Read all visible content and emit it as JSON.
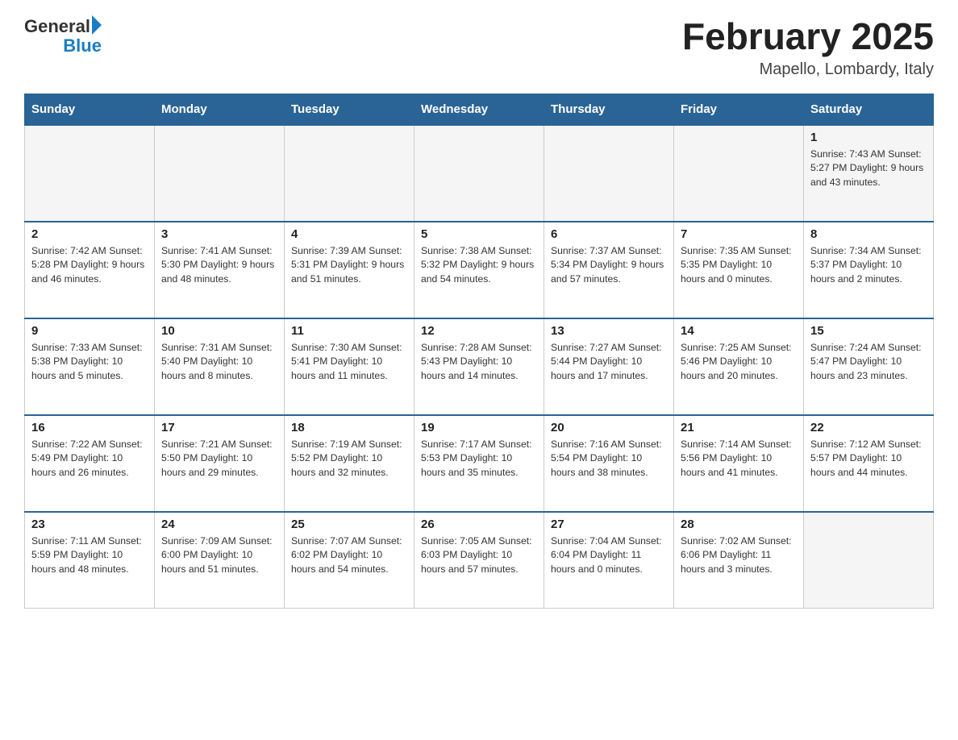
{
  "header": {
    "logo_general": "General",
    "logo_blue": "Blue",
    "month_title": "February 2025",
    "location": "Mapello, Lombardy, Italy"
  },
  "days_of_week": [
    "Sunday",
    "Monday",
    "Tuesday",
    "Wednesday",
    "Thursday",
    "Friday",
    "Saturday"
  ],
  "weeks": [
    {
      "days": [
        {
          "num": "",
          "info": ""
        },
        {
          "num": "",
          "info": ""
        },
        {
          "num": "",
          "info": ""
        },
        {
          "num": "",
          "info": ""
        },
        {
          "num": "",
          "info": ""
        },
        {
          "num": "",
          "info": ""
        },
        {
          "num": "1",
          "info": "Sunrise: 7:43 AM\nSunset: 5:27 PM\nDaylight: 9 hours and 43 minutes."
        }
      ]
    },
    {
      "days": [
        {
          "num": "2",
          "info": "Sunrise: 7:42 AM\nSunset: 5:28 PM\nDaylight: 9 hours and 46 minutes."
        },
        {
          "num": "3",
          "info": "Sunrise: 7:41 AM\nSunset: 5:30 PM\nDaylight: 9 hours and 48 minutes."
        },
        {
          "num": "4",
          "info": "Sunrise: 7:39 AM\nSunset: 5:31 PM\nDaylight: 9 hours and 51 minutes."
        },
        {
          "num": "5",
          "info": "Sunrise: 7:38 AM\nSunset: 5:32 PM\nDaylight: 9 hours and 54 minutes."
        },
        {
          "num": "6",
          "info": "Sunrise: 7:37 AM\nSunset: 5:34 PM\nDaylight: 9 hours and 57 minutes."
        },
        {
          "num": "7",
          "info": "Sunrise: 7:35 AM\nSunset: 5:35 PM\nDaylight: 10 hours and 0 minutes."
        },
        {
          "num": "8",
          "info": "Sunrise: 7:34 AM\nSunset: 5:37 PM\nDaylight: 10 hours and 2 minutes."
        }
      ]
    },
    {
      "days": [
        {
          "num": "9",
          "info": "Sunrise: 7:33 AM\nSunset: 5:38 PM\nDaylight: 10 hours and 5 minutes."
        },
        {
          "num": "10",
          "info": "Sunrise: 7:31 AM\nSunset: 5:40 PM\nDaylight: 10 hours and 8 minutes."
        },
        {
          "num": "11",
          "info": "Sunrise: 7:30 AM\nSunset: 5:41 PM\nDaylight: 10 hours and 11 minutes."
        },
        {
          "num": "12",
          "info": "Sunrise: 7:28 AM\nSunset: 5:43 PM\nDaylight: 10 hours and 14 minutes."
        },
        {
          "num": "13",
          "info": "Sunrise: 7:27 AM\nSunset: 5:44 PM\nDaylight: 10 hours and 17 minutes."
        },
        {
          "num": "14",
          "info": "Sunrise: 7:25 AM\nSunset: 5:46 PM\nDaylight: 10 hours and 20 minutes."
        },
        {
          "num": "15",
          "info": "Sunrise: 7:24 AM\nSunset: 5:47 PM\nDaylight: 10 hours and 23 minutes."
        }
      ]
    },
    {
      "days": [
        {
          "num": "16",
          "info": "Sunrise: 7:22 AM\nSunset: 5:49 PM\nDaylight: 10 hours and 26 minutes."
        },
        {
          "num": "17",
          "info": "Sunrise: 7:21 AM\nSunset: 5:50 PM\nDaylight: 10 hours and 29 minutes."
        },
        {
          "num": "18",
          "info": "Sunrise: 7:19 AM\nSunset: 5:52 PM\nDaylight: 10 hours and 32 minutes."
        },
        {
          "num": "19",
          "info": "Sunrise: 7:17 AM\nSunset: 5:53 PM\nDaylight: 10 hours and 35 minutes."
        },
        {
          "num": "20",
          "info": "Sunrise: 7:16 AM\nSunset: 5:54 PM\nDaylight: 10 hours and 38 minutes."
        },
        {
          "num": "21",
          "info": "Sunrise: 7:14 AM\nSunset: 5:56 PM\nDaylight: 10 hours and 41 minutes."
        },
        {
          "num": "22",
          "info": "Sunrise: 7:12 AM\nSunset: 5:57 PM\nDaylight: 10 hours and 44 minutes."
        }
      ]
    },
    {
      "days": [
        {
          "num": "23",
          "info": "Sunrise: 7:11 AM\nSunset: 5:59 PM\nDaylight: 10 hours and 48 minutes."
        },
        {
          "num": "24",
          "info": "Sunrise: 7:09 AM\nSunset: 6:00 PM\nDaylight: 10 hours and 51 minutes."
        },
        {
          "num": "25",
          "info": "Sunrise: 7:07 AM\nSunset: 6:02 PM\nDaylight: 10 hours and 54 minutes."
        },
        {
          "num": "26",
          "info": "Sunrise: 7:05 AM\nSunset: 6:03 PM\nDaylight: 10 hours and 57 minutes."
        },
        {
          "num": "27",
          "info": "Sunrise: 7:04 AM\nSunset: 6:04 PM\nDaylight: 11 hours and 0 minutes."
        },
        {
          "num": "28",
          "info": "Sunrise: 7:02 AM\nSunset: 6:06 PM\nDaylight: 11 hours and 3 minutes."
        },
        {
          "num": "",
          "info": ""
        }
      ]
    }
  ]
}
